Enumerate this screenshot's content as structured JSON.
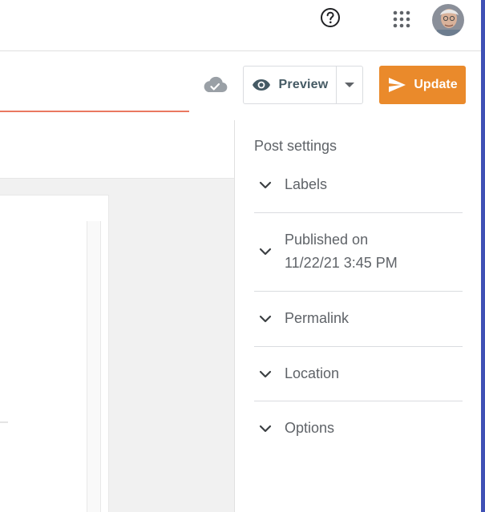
{
  "header": {
    "help_icon": "help-circle-icon",
    "apps_icon": "apps-grid-icon",
    "avatar_icon": "user-avatar"
  },
  "toolbar": {
    "save_status_icon": "cloud-check-icon",
    "preview_label": "Preview",
    "preview_icon": "eye-icon",
    "preview_dropdown_icon": "caret-down-icon",
    "update_label": "Update",
    "update_icon": "send-icon"
  },
  "settings": {
    "title": "Post settings",
    "items": [
      {
        "label": "Labels"
      },
      {
        "label": "Published on",
        "detail": "11/22/21 3:45 PM"
      },
      {
        "label": "Permalink"
      },
      {
        "label": "Location"
      },
      {
        "label": "Options"
      }
    ]
  },
  "colors": {
    "update_button": "#ea8a2b",
    "title_underline": "#ea7860",
    "right_edge": "#3f51b5",
    "text_secondary": "#5f6368"
  }
}
